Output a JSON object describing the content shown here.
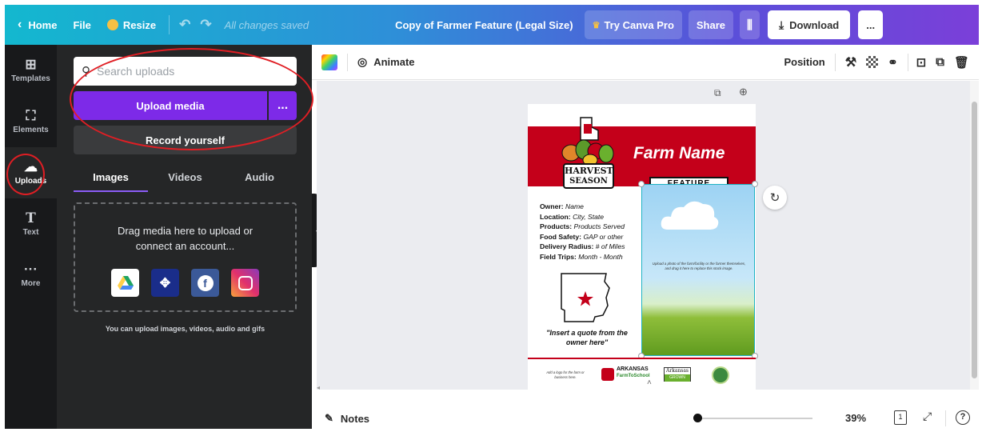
{
  "topbar": {
    "home": "Home",
    "file": "File",
    "resize": "Resize",
    "saved_status": "All changes saved",
    "doc_title": "Copy of Farmer Feature (Legal Size)",
    "try_pro": "Try Canva Pro",
    "share": "Share",
    "download": "Download",
    "more": "..."
  },
  "rail": {
    "items": [
      {
        "label": "Templates",
        "icon": "templates-icon"
      },
      {
        "label": "Elements",
        "icon": "elements-icon"
      },
      {
        "label": "Uploads",
        "icon": "uploads-icon"
      },
      {
        "label": "Text",
        "icon": "text-icon"
      },
      {
        "label": "More",
        "icon": "more-icon"
      }
    ]
  },
  "panel": {
    "search_placeholder": "Search uploads",
    "upload_media": "Upload media",
    "upload_more": "...",
    "record_yourself": "Record yourself",
    "tabs": [
      "Images",
      "Videos",
      "Audio"
    ],
    "dropzone_text_1": "Drag media here to upload or",
    "dropzone_text_2": "connect an account...",
    "hint": "You can upload images, videos, audio and gifs"
  },
  "toolbar": {
    "animate": "Animate",
    "position": "Position"
  },
  "flyer": {
    "farm_name": "Farm Name",
    "feature": "FEATURE",
    "harvest_1": "HARVEST",
    "harvest_2": "SEASON",
    "info": [
      {
        "label": "Owner:",
        "value": "Name"
      },
      {
        "label": "Location:",
        "value": "City, State"
      },
      {
        "label": "Products:",
        "value": "Products Served"
      },
      {
        "label": "Food Safety:",
        "value": "GAP or other"
      },
      {
        "label": "Delivery Radius:",
        "value": "# of Miles"
      },
      {
        "label": "Field Trips:",
        "value": "Month - Month"
      }
    ],
    "photo_caption": "Upload a photo of the farm/facility or the farmer themselves, and drag it here to replace this stock image.",
    "quote": "\"Insert a quote from the owner here\"",
    "footer_caption": "Add a logo for the farm or business here.",
    "logo_arkansas": "ARKANSAS",
    "logo_farm_to_school": "FarmToSchool",
    "logo_arkansas2": "Arkansas",
    "logo_grown": "GROWN"
  },
  "bottombar": {
    "notes": "Notes",
    "zoom": "39%",
    "page_num": "1",
    "help": "?"
  },
  "colors": {
    "accent_purple": "#7d2ae8",
    "flyer_red": "#c4001a",
    "annotation_red": "#e01e24"
  }
}
